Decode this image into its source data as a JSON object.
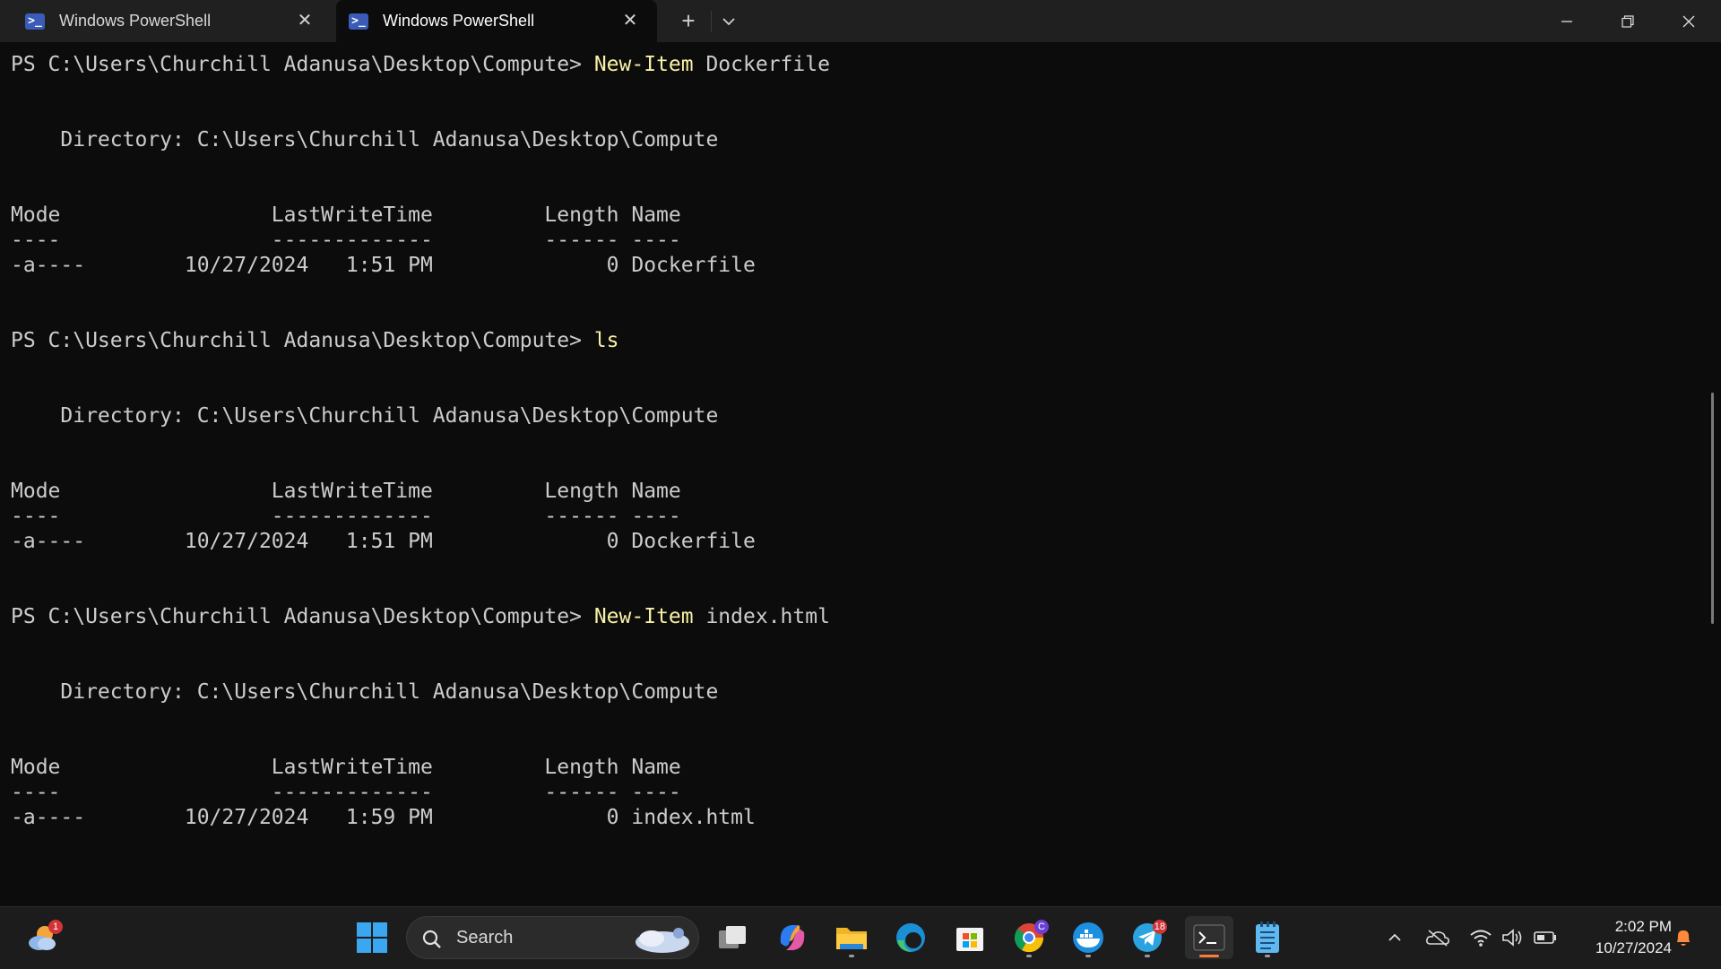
{
  "window": {
    "tabs": [
      {
        "label": "Windows PowerShell",
        "active": false,
        "icon": "powershell-icon"
      },
      {
        "label": "Windows PowerShell",
        "active": true,
        "icon": "powershell-icon"
      }
    ],
    "new_tab_label": "+",
    "tab_icon_glyph": ">_",
    "controls": [
      "minimize-icon",
      "restore-icon",
      "close-icon"
    ]
  },
  "terminal": {
    "lines": [
      {
        "text": "PS C:\\Users\\Churchill Adanusa\\Desktop\\Compute> ",
        "cmd": "New-Item",
        "arg": " Dockerfile"
      },
      {
        "text": ""
      },
      {
        "text": ""
      },
      {
        "text": "    Directory: C:\\Users\\Churchill Adanusa\\Desktop\\Compute"
      },
      {
        "text": ""
      },
      {
        "text": ""
      },
      {
        "text": "Mode                 LastWriteTime         Length Name"
      },
      {
        "text": "----                 -------------         ------ ----"
      },
      {
        "text": "-a----        10/27/2024   1:51 PM              0 Dockerfile"
      },
      {
        "text": ""
      },
      {
        "text": ""
      },
      {
        "text": "PS C:\\Users\\Churchill Adanusa\\Desktop\\Compute> ",
        "cmd": "ls",
        "arg": ""
      },
      {
        "text": ""
      },
      {
        "text": ""
      },
      {
        "text": "    Directory: C:\\Users\\Churchill Adanusa\\Desktop\\Compute"
      },
      {
        "text": ""
      },
      {
        "text": ""
      },
      {
        "text": "Mode                 LastWriteTime         Length Name"
      },
      {
        "text": "----                 -------------         ------ ----"
      },
      {
        "text": "-a----        10/27/2024   1:51 PM              0 Dockerfile"
      },
      {
        "text": ""
      },
      {
        "text": ""
      },
      {
        "text": "PS C:\\Users\\Churchill Adanusa\\Desktop\\Compute> ",
        "cmd": "New-Item",
        "arg": " index.html"
      },
      {
        "text": ""
      },
      {
        "text": ""
      },
      {
        "text": "    Directory: C:\\Users\\Churchill Adanusa\\Desktop\\Compute"
      },
      {
        "text": ""
      },
      {
        "text": ""
      },
      {
        "text": "Mode                 LastWriteTime         Length Name"
      },
      {
        "text": "----                 -------------         ------ ----"
      },
      {
        "text": "-a----        10/27/2024   1:59 PM              0 index.html"
      }
    ]
  },
  "taskbar": {
    "widgets_badge": "1",
    "search_placeholder": "Search",
    "chrome_profile_badge": "C",
    "telegram_badge": "18",
    "clock_time": "2:02 PM",
    "clock_date": "10/27/2024"
  },
  "colors": {
    "terminal_bg": "#0c0c0c",
    "command_color": "#f9f1a5",
    "titlebar_bg": "#202020",
    "taskbar_bg": "#1c1c1c"
  }
}
